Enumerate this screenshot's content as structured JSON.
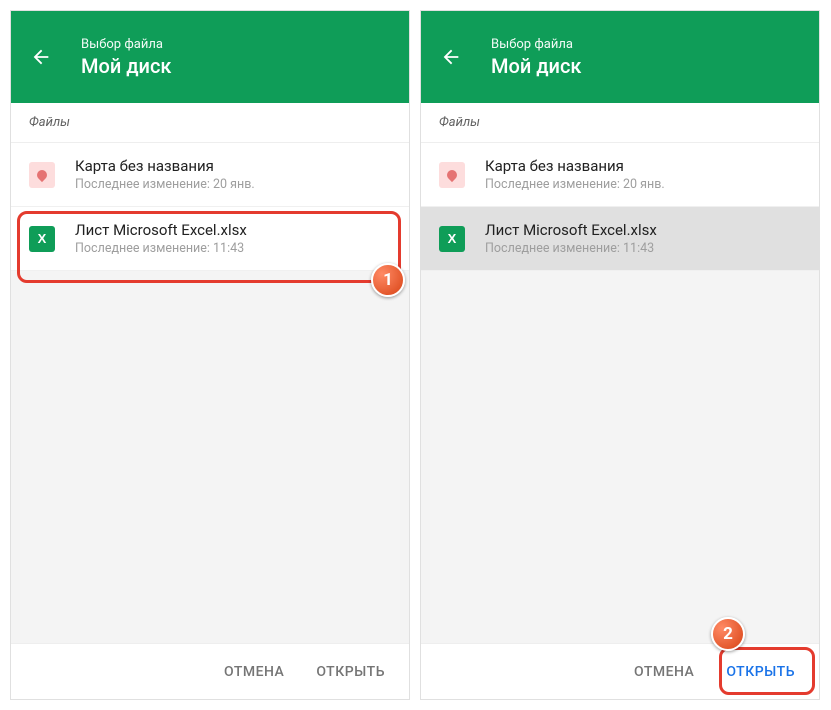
{
  "header": {
    "subtitle": "Выбор файла",
    "title": "Мой диск"
  },
  "section_label": "Файлы",
  "files": [
    {
      "title": "Карта без названия",
      "meta": "Последнее изменение: 20 янв."
    },
    {
      "title": "Лист Microsoft Excel.xlsx",
      "meta": "Последнее изменение: 11:43"
    }
  ],
  "buttons": {
    "cancel": "ОТМЕНА",
    "open": "ОТКРЫТЬ"
  },
  "badges": {
    "one": "1",
    "two": "2"
  }
}
